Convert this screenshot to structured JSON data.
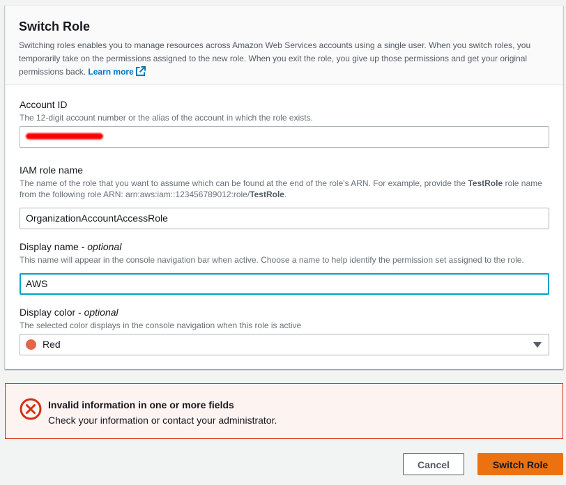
{
  "header": {
    "title": "Switch Role",
    "description": "Switching roles enables you to manage resources across Amazon Web Services accounts using a single user. When you switch roles, you temporarily take on the permissions assigned to the new role. When you exit the role, you give up those permissions and get your original permissions back.",
    "learn_more": "Learn more",
    "learn_more_icon": "external-link-icon"
  },
  "account_id": {
    "label": "Account ID",
    "hint": "The 12-digit account number or the alias of the account in which the role exists.",
    "value": "",
    "redaction_color": "#ff0000"
  },
  "role_name": {
    "label": "IAM role name",
    "hint_part1": "The name of the role that you want to assume which can be found at the end of the role's ARN. For example, provide the ",
    "hint_bold1": "TestRole",
    "hint_part2": " role name from the following role ARN: arn:aws:iam::123456789012:role/",
    "hint_bold2": "TestRole",
    "hint_part3": ".",
    "value": "OrganizationAccountAccessRole"
  },
  "display_name": {
    "label": "Display name - ",
    "label_optional": "optional",
    "hint": "This name will appear in the console navigation bar when active. Choose a name to help identify the permission set assigned to the role.",
    "value": "AWS"
  },
  "display_color": {
    "label": "Display color - ",
    "label_optional": "optional",
    "hint": "The selected color displays in the console navigation when this role is active",
    "selected": "Red",
    "swatch_color": "#e4664a"
  },
  "error": {
    "icon": "error-x-icon",
    "title": "Invalid information in one or more fields",
    "message": "Check your information or contact your administrator.",
    "color": "#d13212"
  },
  "actions": {
    "cancel": "Cancel",
    "submit": "Switch Role",
    "primary_color": "#ec7211"
  }
}
